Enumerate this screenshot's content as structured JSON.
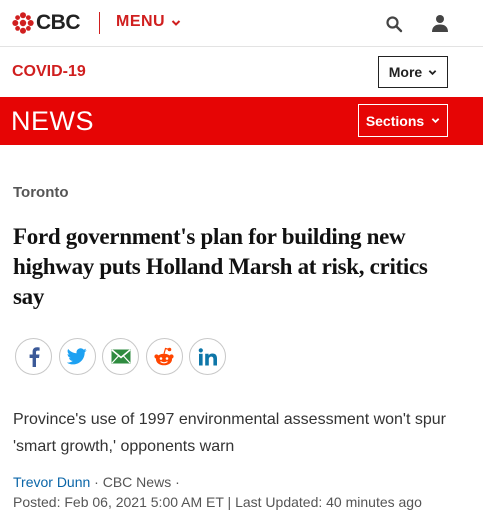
{
  "header": {
    "logo_text": "CBC",
    "menu_label": "MENU",
    "search_icon": "search-icon",
    "user_icon": "user-icon",
    "brand_red": "#d01f1f"
  },
  "subheader": {
    "covid_label": "COVID-19",
    "more_label": "More"
  },
  "news_bar": {
    "title": "NEWS",
    "sections_label": "Sections",
    "background": "#e60505"
  },
  "article": {
    "category": "Toronto",
    "headline": "Ford government's plan for building new highway puts Holland Marsh at risk, critics say",
    "share_buttons": [
      "facebook-icon",
      "twitter-icon",
      "email-icon",
      "reddit-icon",
      "linkedin-icon"
    ],
    "deck": "Province's use of 1997 environmental assessment won't spur 'smart growth,' opponents warn",
    "author": "Trevor Dunn",
    "source": " · CBC News ·",
    "dateline": "Posted: Feb 06, 2021 5:00 AM ET | Last Updated: 40 minutes ago"
  }
}
